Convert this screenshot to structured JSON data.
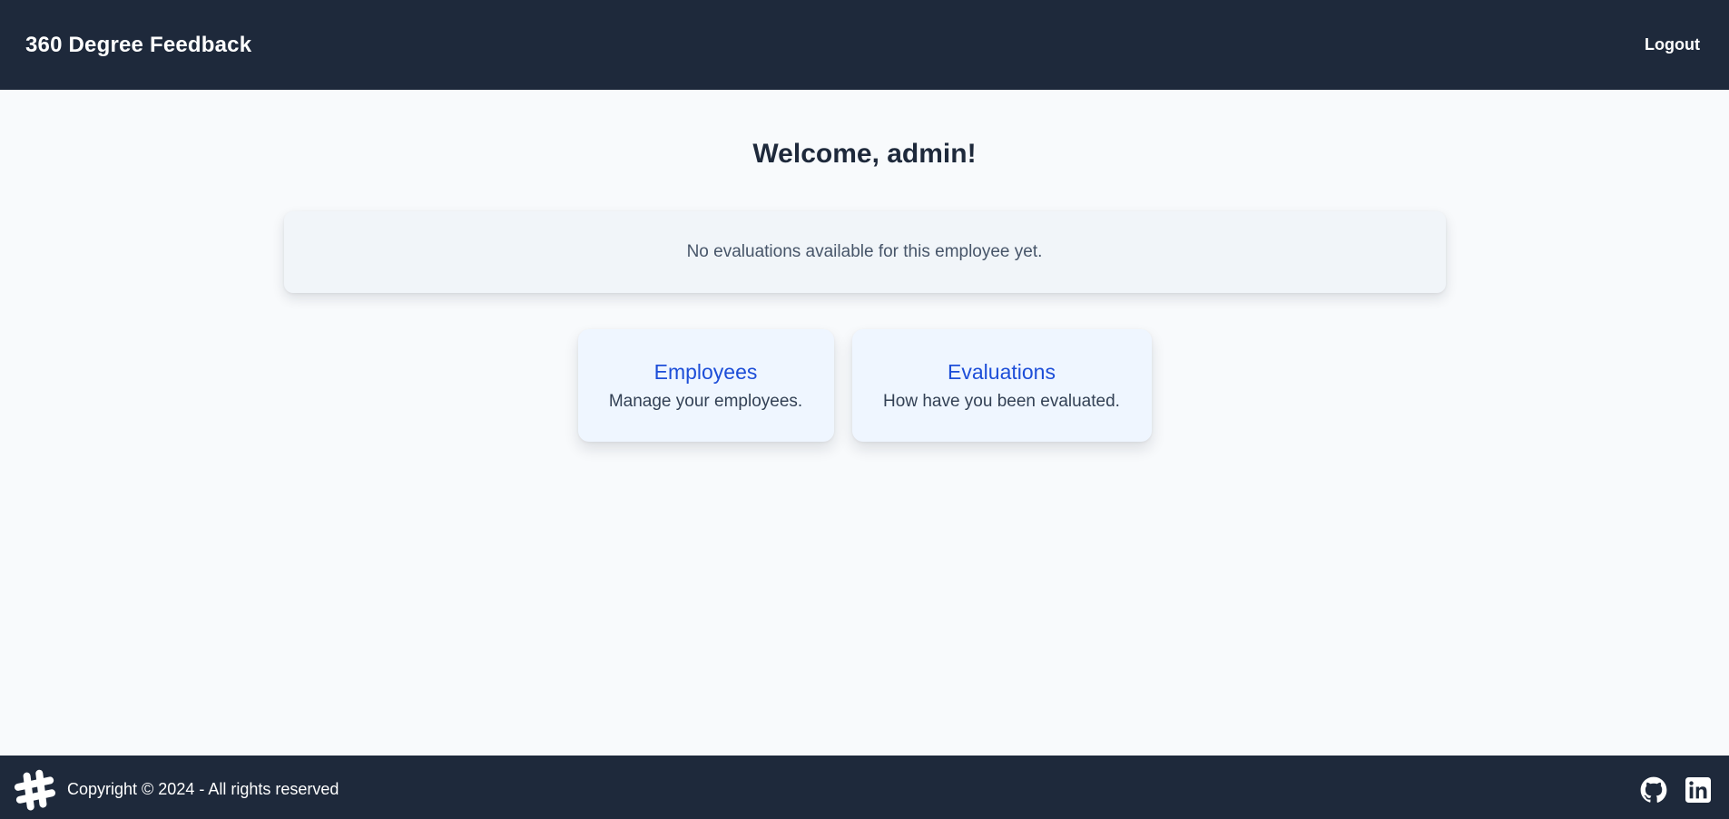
{
  "header": {
    "brand": "360 Degree Feedback",
    "logout_label": "Logout"
  },
  "main": {
    "welcome": "Welcome, admin!",
    "notice": "No evaluations available for this employee yet.",
    "cards": [
      {
        "title": "Employees",
        "description": "Manage your employees."
      },
      {
        "title": "Evaluations",
        "description": "How have you been evaluated."
      }
    ]
  },
  "footer": {
    "copyright": "Copyright © 2024 - All rights reserved",
    "logo_icon": "hashtag-icon",
    "social_icons": [
      "github-icon",
      "linkedin-icon"
    ]
  },
  "colors": {
    "header_bg": "#1e293b",
    "page_bg": "#f8fafc",
    "card_bg": "#eff6ff",
    "card_title": "#1d4ed8",
    "notice_bg": "#f1f5f9"
  }
}
